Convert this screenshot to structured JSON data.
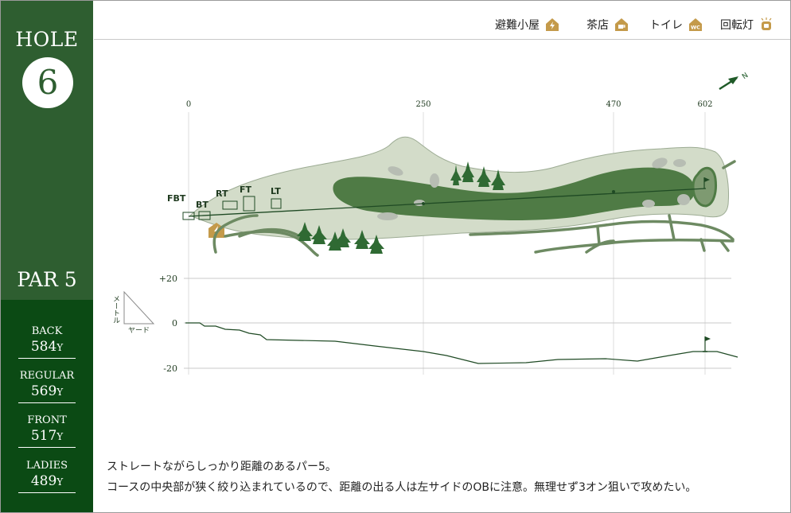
{
  "hole": {
    "label": "HOLE",
    "number": "6"
  },
  "par": {
    "label": "PAR 5"
  },
  "tees": [
    {
      "name": "BACK",
      "yards": "584",
      "unit": "Y"
    },
    {
      "name": "REGULAR",
      "yards": "569",
      "unit": "Y"
    },
    {
      "name": "FRONT",
      "yards": "517",
      "unit": "Y"
    },
    {
      "name": "LADIES",
      "yards": "489",
      "unit": "Y"
    }
  ],
  "legend": [
    {
      "label": "避難小屋",
      "icon": "lightning-shelter-icon"
    },
    {
      "label": "茶店",
      "icon": "tea-house-icon"
    },
    {
      "label": "トイレ",
      "icon": "toilet-icon",
      "badge": "WC"
    },
    {
      "label": "回転灯",
      "icon": "beacon-light-icon"
    }
  ],
  "map": {
    "distance_markers": [
      "0",
      "250",
      "470",
      "602"
    ],
    "tee_labels": [
      "FBT",
      "BT",
      "RT",
      "FT",
      "LT"
    ],
    "compass": "N",
    "elevation_labels": [
      "+20",
      "0",
      "-20"
    ],
    "units_vertical": "メートル",
    "units_horizontal": "ヤード"
  },
  "colors": {
    "sidebar": "#2e5e30",
    "sidebar_dark": "#0b4a14",
    "rough": "#d3dcc9",
    "fairway": "#4f7b45",
    "path": "#6d8a62",
    "tree": "#2f6a33",
    "icon_gold": "#c49a4a"
  },
  "description": {
    "line1": "ストレートながらしっかり距離のあるパー5。",
    "line2": "コースの中央部が狭く絞り込まれているので、距離の出る人は左サイドのOBに注意。無理せず3オン狙いで攻めたい。"
  }
}
